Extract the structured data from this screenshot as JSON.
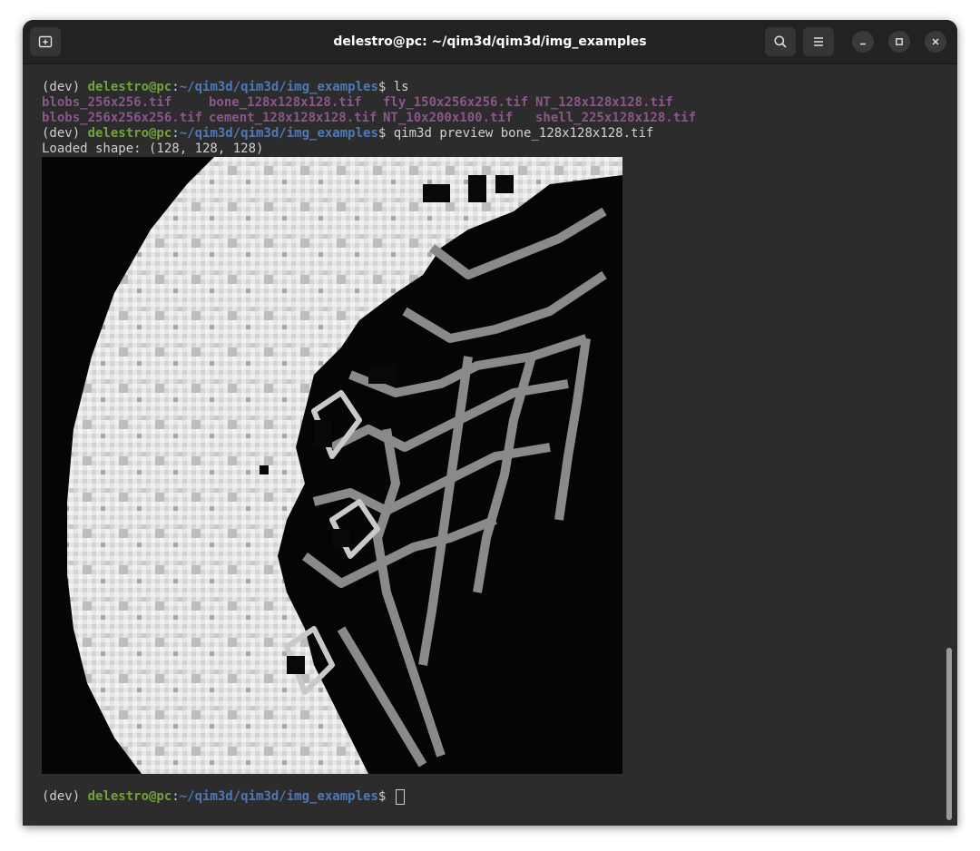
{
  "window": {
    "title": "delestro@pc: ~/qim3d/qim3d/img_examples"
  },
  "icons": {
    "new_tab": "new-tab-icon",
    "search": "search-icon",
    "menu": "hamburger-menu-icon",
    "minimize": "minimize-icon",
    "maximize": "maximize-icon",
    "close": "close-icon"
  },
  "colors": {
    "user_host": "#72a33a",
    "path": "#4f78b7",
    "tif_file": "#8b568c",
    "text": "#d0d0d0",
    "background": "#2c2c2c"
  },
  "prompt": {
    "env": "(dev) ",
    "user_host": "delestro@pc",
    "colon": ":",
    "path": "~/qim3d/qim3d/img_examples",
    "dollar": "$ "
  },
  "commands": {
    "ls": "ls",
    "preview": "qim3d preview bone_128x128x128.tif"
  },
  "ls_output": [
    "blobs_256x256.tif",
    "blobs_256x256x256.tif",
    "bone_128x128x128.tif",
    "cement_128x128x128.tif",
    "fly_150x256x256.tif",
    "NT_10x200x100.tif",
    "NT_128x128x128.tif",
    "shell_225x128x128.tif"
  ],
  "output": {
    "loaded_shape": "Loaded shape: (128, 128, 128)"
  }
}
